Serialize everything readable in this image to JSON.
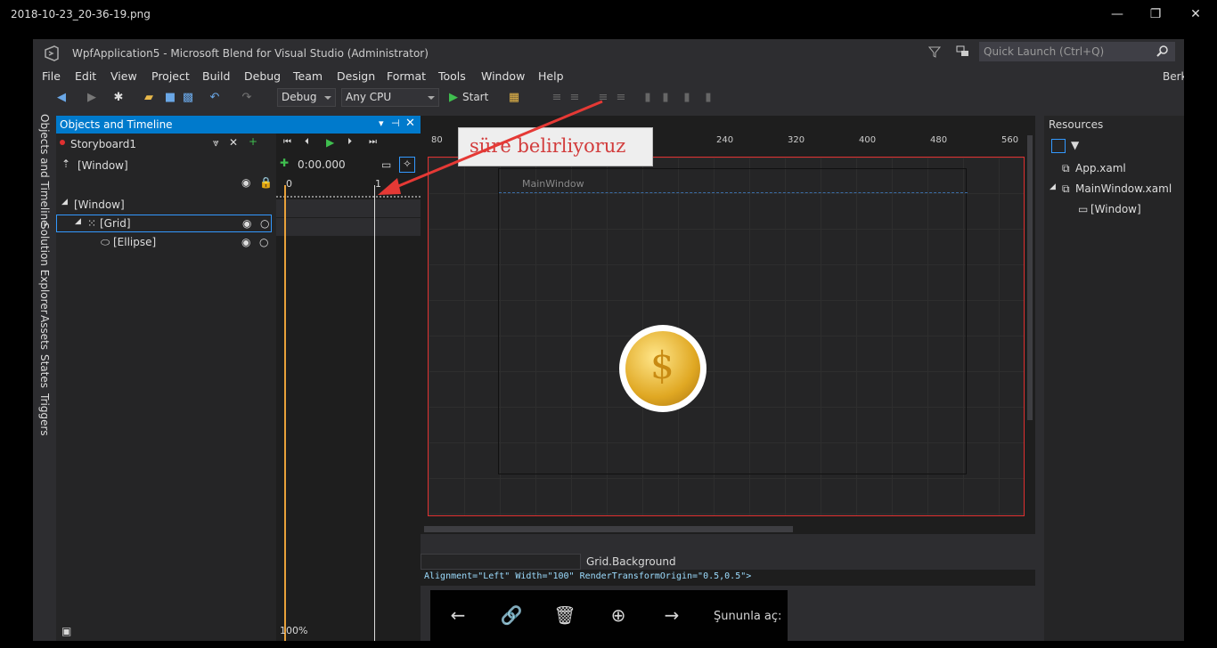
{
  "viewer": {
    "filename": "2018-10-23_20-36-19.png",
    "minimize": "—",
    "restore": "❐",
    "close": "✕"
  },
  "app": {
    "title": "WpfApplication5 - Microsoft Blend for Visual Studio (Administrator)",
    "quick_launch": "Quick Launch (Ctrl+Q)",
    "user": "Berk"
  },
  "menu": [
    "File",
    "Edit",
    "View",
    "Project",
    "Build",
    "Debug",
    "Team",
    "Design",
    "Format",
    "Tools",
    "Window",
    "Help"
  ],
  "toolbar": {
    "config": "Debug",
    "platform": "Any CPU",
    "start": "Start"
  },
  "left_tabs": [
    "Objects and Timeline",
    "Solution Explorer",
    "Assets",
    "States",
    "Triggers"
  ],
  "objects": {
    "title": "Objects and Timeline",
    "storyboard": "Storyboard1",
    "window_root": "[Window]",
    "time": "0:00.000",
    "tree": [
      "[Window]",
      "[Grid]",
      "[Ellipse]"
    ],
    "zoom": "100%",
    "tl_marks": [
      "0",
      "1"
    ]
  },
  "canvas": {
    "ruler": [
      "80",
      "240",
      "320",
      "400",
      "480",
      "560"
    ],
    "window_label": "MainWindow"
  },
  "callout": {
    "text": "süre belirliyoruz"
  },
  "resources": {
    "title": "Resources",
    "items": [
      "App.xaml",
      "MainWindow.xaml",
      "[Window]"
    ]
  },
  "bottom": {
    "property": "Grid.Background",
    "xaml": "Alignment=\"Left\" Width=\"100\" RenderTransformOrigin=\"0.5,0.5\">"
  },
  "overlay": {
    "open_with": "Şununla aç:"
  },
  "colors": {
    "accent": "#007acc",
    "arrow": "#e53935",
    "selection_border": "#e03030"
  }
}
